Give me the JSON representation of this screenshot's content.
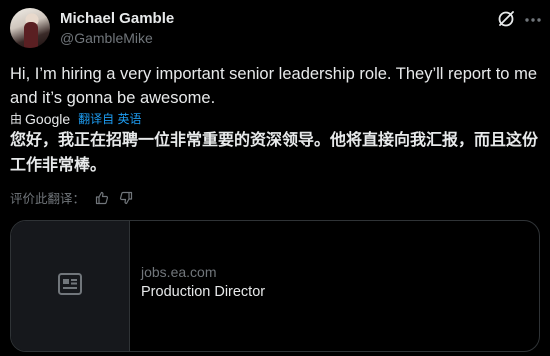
{
  "author": {
    "name": "Michael Gamble",
    "handle": "@GambleMike"
  },
  "tweet": {
    "text": "Hi, I’m hiring a very important senior leadership role. They’ll report to me and it’s gonna be awesome."
  },
  "translation": {
    "by_prefix": "由",
    "provider": "Google",
    "action": "翻译自 英语",
    "text": "您好，我正在招聘一位非常重要的资深领导。他将直接向我汇报，而且这份工作非常棒。",
    "rate_label": "评价此翻译："
  },
  "link_card": {
    "domain": "jobs.ea.com",
    "title": "Production Director"
  },
  "colors": {
    "background": "#000000",
    "text": "#e7e9ea",
    "muted": "#71767b",
    "link": "#1d9bf0",
    "border": "#2f3336"
  },
  "icons": [
    "grok-icon",
    "more-icon",
    "thumbs-up-icon",
    "thumbs-down-icon",
    "article-icon"
  ]
}
